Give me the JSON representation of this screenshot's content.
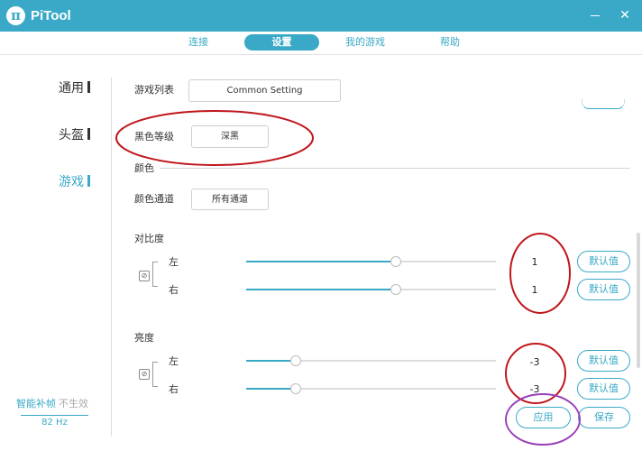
{
  "titlebar": {
    "logo_glyph": "π",
    "title": "PiTool",
    "close_glyph": "✕",
    "bg_color": "#3aa9c7"
  },
  "nav": {
    "tabs": [
      {
        "label": "连接",
        "active": false
      },
      {
        "label": "设置",
        "active": true
      },
      {
        "label": "我的游戏",
        "active": false
      },
      {
        "label": "帮助",
        "active": false
      }
    ]
  },
  "sidebar": {
    "items": [
      {
        "label": "通用",
        "active": false
      },
      {
        "label": "头盔",
        "active": false
      },
      {
        "label": "游戏",
        "active": true
      }
    ],
    "frame_interp": {
      "label": "智能补帧",
      "status": "不生效",
      "rate": "82 Hz"
    }
  },
  "settings": {
    "game_list": {
      "label": "游戏列表",
      "value": "Common Setting"
    },
    "black_level": {
      "label": "黑色等级",
      "value": "深黑"
    },
    "color_section": "颜色",
    "color_channel": {
      "label": "颜色通道",
      "value": "所有通道"
    },
    "contrast": {
      "title": "对比度",
      "left_label": "左",
      "right_label": "右",
      "left_value": "1",
      "right_value": "1",
      "left_fraction": 0.6,
      "right_fraction": 0.6,
      "default_label": "默认值"
    },
    "brightness": {
      "title": "亮度",
      "left_label": "左",
      "right_label": "右",
      "left_value": "-3",
      "right_value": "-3",
      "left_fraction": 0.2,
      "right_fraction": 0.2,
      "default_label": "默认值"
    },
    "apply_label": "应用",
    "save_label": "保存"
  },
  "annotation_colors": {
    "red": "#c0161c",
    "purple": "#9b3db8"
  },
  "accent_color": "#3aa9c7"
}
